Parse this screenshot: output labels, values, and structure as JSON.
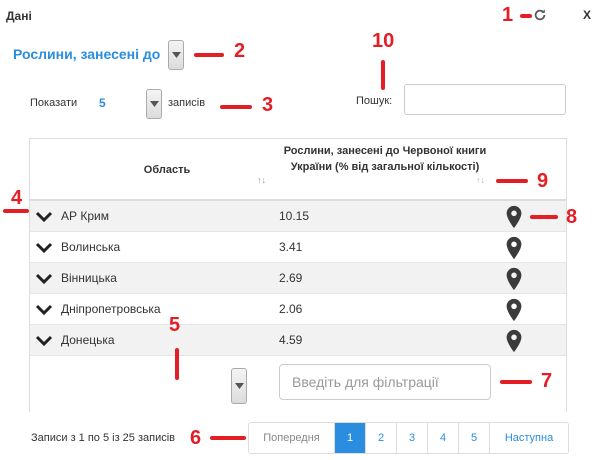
{
  "window": {
    "title": "Дані",
    "close_label": "X"
  },
  "dataset": {
    "selected": "Рослини, занесені до"
  },
  "length": {
    "show_label": "Показати",
    "value": "5",
    "records_label": "записів"
  },
  "search": {
    "label": "Пошук:",
    "value": "",
    "placeholder": ""
  },
  "table": {
    "columns": [
      "Область",
      "Рослини, занесені до Червоної книги України (% від загальної кількості)"
    ],
    "rows": [
      {
        "region": "АР Крим",
        "value": "10.15"
      },
      {
        "region": "Волинська",
        "value": "3.41"
      },
      {
        "region": "Вінницька",
        "value": "2.69"
      },
      {
        "region": "Дніпропетровська",
        "value": "2.06"
      },
      {
        "region": "Донецька",
        "value": "4.59"
      }
    ],
    "filter_placeholder": "Введіть для фільтрації"
  },
  "info": "Записи з 1 по 5 із 25 записів",
  "pagination": {
    "previous": "Попередня",
    "pages": [
      "1",
      "2",
      "3",
      "4",
      "5"
    ],
    "active_page": "1",
    "next": "Наступна"
  },
  "annotations": [
    "1",
    "2",
    "3",
    "4",
    "5",
    "6",
    "7",
    "8",
    "9",
    "10"
  ],
  "colors": {
    "accent": "#2a8de0",
    "annotation": "#e41e25",
    "row_stripe": "#f2f2f2"
  },
  "icons": [
    "refresh-icon",
    "chevron-down-icon",
    "sort-icon",
    "map-pin-icon"
  ]
}
